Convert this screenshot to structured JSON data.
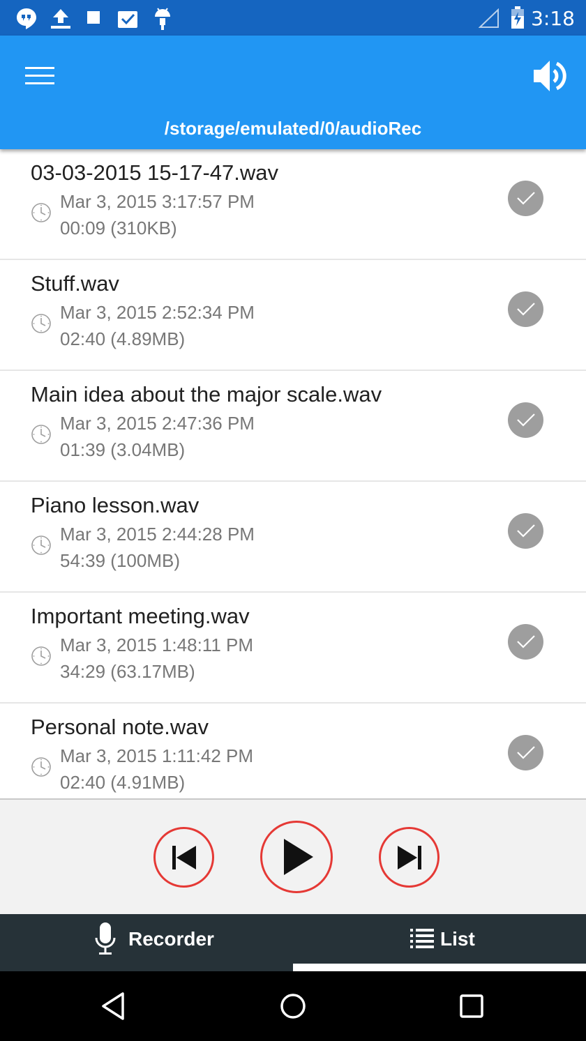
{
  "status_bar": {
    "time": "3:18",
    "icons": [
      "hangouts-icon",
      "upload-icon",
      "stop-icon",
      "clipboard-check-icon",
      "android-icon",
      "signal-icon",
      "battery-charging-icon"
    ]
  },
  "app_bar": {
    "path": "/storage/emulated/0/audioRec",
    "menu_icon": "hamburger-menu-icon",
    "volume_icon": "volume-icon",
    "color": "#2196f3"
  },
  "recordings": [
    {
      "name": "03-03-2015 15-17-47.wav",
      "date": "Mar 3, 2015 3:17:57 PM",
      "duration": "00:09 (310KB)"
    },
    {
      "name": "Stuff.wav",
      "date": "Mar 3, 2015 2:52:34 PM",
      "duration": "02:40 (4.89MB)"
    },
    {
      "name": "Main idea about the major scale.wav",
      "date": "Mar 3, 2015 2:47:36 PM",
      "duration": "01:39 (3.04MB)"
    },
    {
      "name": "Piano lesson.wav",
      "date": "Mar 3, 2015 2:44:28 PM",
      "duration": "54:39 (100MB)"
    },
    {
      "name": "Important meeting.wav",
      "date": "Mar 3, 2015 1:48:11 PM",
      "duration": "34:29 (63.17MB)"
    },
    {
      "name": "Personal note.wav",
      "date": "Mar 3, 2015 1:11:42 PM",
      "duration": "02:40 (4.91MB)"
    }
  ],
  "player": {
    "accent_color": "#e53935",
    "buttons": [
      "skip-previous-icon",
      "play-icon",
      "skip-next-icon"
    ]
  },
  "tabs": [
    {
      "label": "Recorder",
      "icon": "microphone-icon",
      "selected": false
    },
    {
      "label": "List",
      "icon": "list-icon",
      "selected": true
    }
  ],
  "nav_bar": {
    "buttons": [
      "back-icon",
      "home-icon",
      "recents-icon"
    ]
  }
}
